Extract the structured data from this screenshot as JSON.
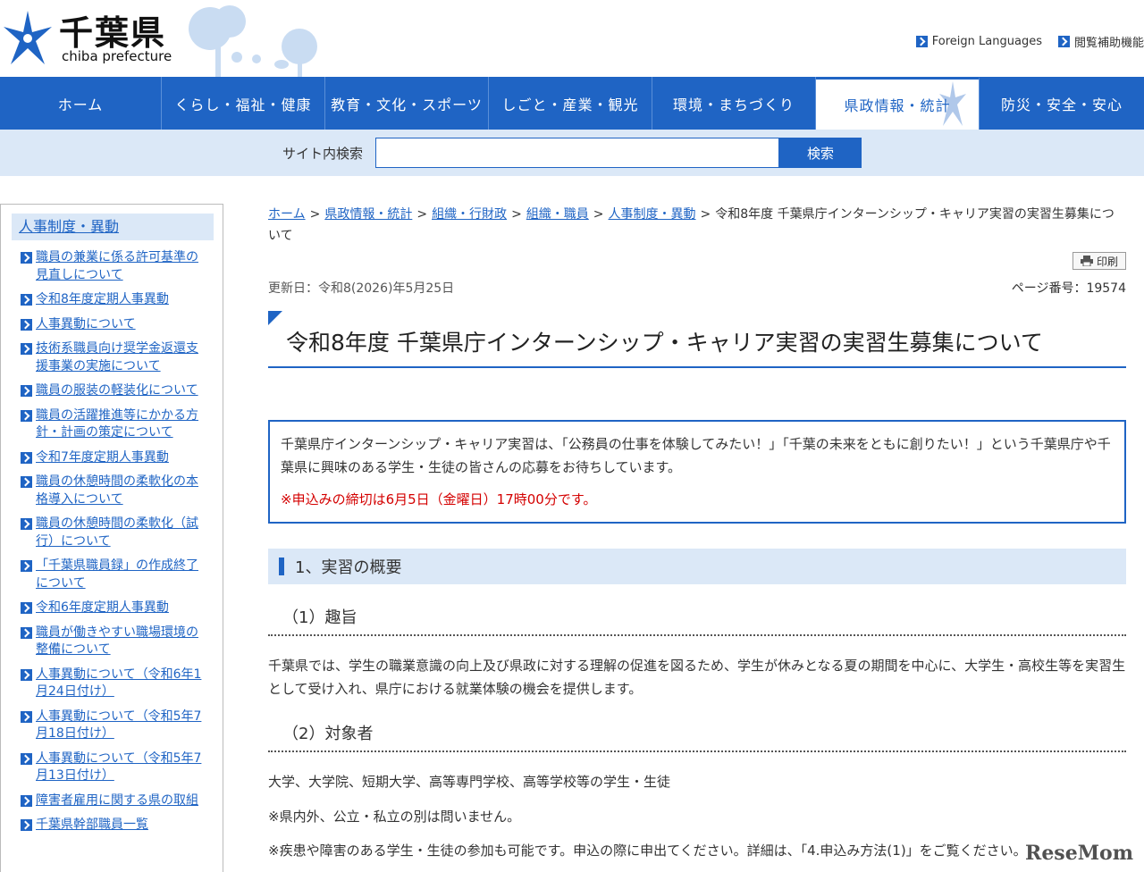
{
  "header": {
    "logo_kanji": "千葉県",
    "logo_en": "chiba prefecture",
    "util_links": [
      "Foreign Languages",
      "閲覧補助機能"
    ]
  },
  "nav": {
    "items": [
      {
        "label": "ホーム",
        "active": false
      },
      {
        "label": "くらし・福祉・健康",
        "active": false
      },
      {
        "label": "教育・文化・スポーツ",
        "active": false
      },
      {
        "label": "しごと・産業・観光",
        "active": false
      },
      {
        "label": "環境・まちづくり",
        "active": false
      },
      {
        "label": "県政情報・統計",
        "active": true
      },
      {
        "label": "防災・安全・安心",
        "active": false
      }
    ]
  },
  "search": {
    "label": "サイト内検索",
    "value": "",
    "button": "検索"
  },
  "sidebar": {
    "title": "人事制度・異動",
    "items": [
      "職員の兼業に係る許可基準の見直しについて",
      "令和8年度定期人事異動",
      "人事異動について",
      "技術系職員向け奨学金返還支援事業の実施について",
      "職員の服装の軽装化について",
      "職員の活躍推進等にかかる方針・計画の策定について",
      "令和7年度定期人事異動",
      "職員の休憩時間の柔軟化の本格導入について",
      "職員の休憩時間の柔軟化（試行）について",
      "「千葉県職員録」の作成終了について",
      "令和6年度定期人事異動",
      "職員が働きやすい職場環境の整備について",
      "人事異動について（令和6年1月24日付け）",
      "人事異動について（令和5年7月18日付け）",
      "人事異動について（令和5年7月13日付け）",
      "障害者雇用に関する県の取組",
      "千葉県幹部職員一覧"
    ]
  },
  "breadcrumb": {
    "links": [
      "ホーム",
      "県政情報・統計",
      "組織・行財政",
      "組織・職員",
      "人事制度・異動"
    ],
    "separator": ">",
    "current": "令和8年度 千葉県庁インターンシップ・キャリア実習の実習生募集について"
  },
  "print_label": "印刷",
  "meta": {
    "updated": "更新日：令和8(2026)年5月25日",
    "page_number": "ページ番号：19574"
  },
  "page_title": "令和8年度 千葉県庁インターンシップ・キャリア実習の実習生募集について",
  "notice": {
    "text": "千葉県庁インターンシップ・キャリア実習は、「公務員の仕事を体験してみたい！」「千葉の未来をともに創りたい！」という千葉県庁や千葉県に興味のある学生・生徒の皆さんの応募をお待ちしています。",
    "deadline": "※申込みの締切は6月5日（金曜日）17時00分です。"
  },
  "sections": {
    "h2": "1、実習の概要",
    "h3_purpose": "（1）趣旨",
    "purpose_text": "千葉県では、学生の職業意識の向上及び県政に対する理解の促進を図るため、学生が休みとなる夏の期間を中心に、大学生・高校生等を実習生として受け入れ、県庁における就業体験の機会を提供します。",
    "h3_target": "（2）対象者",
    "target_text": "大学、大学院、短期大学、高等専門学校、高等学校等の学生・生徒",
    "note1": "※県内外、公立・私立の別は問いません。",
    "note2": "※疾患や障害のある学生・生徒の参加も可能です。申込の際に申出てください。詳細は、「4.申込み方法(1)」をご覧ください。"
  },
  "watermark": "ReseMom",
  "colors": {
    "accent": "#1f64c4",
    "light": "#dbe8f7",
    "alert": "#d40000"
  }
}
